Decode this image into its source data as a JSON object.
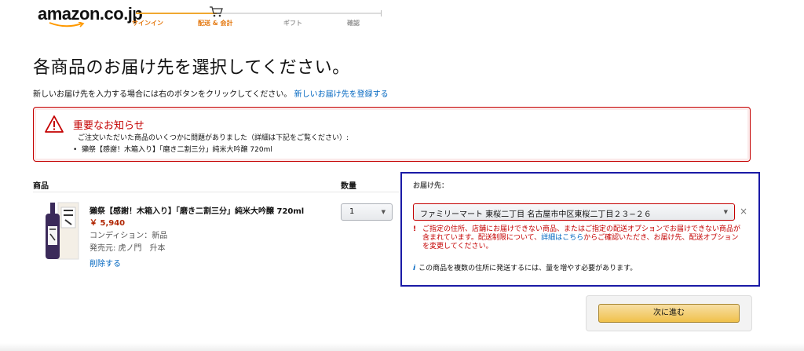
{
  "header": {
    "logo_text": "amazon.co.jp",
    "steps": [
      {
        "label": "サインイン",
        "state": "done"
      },
      {
        "label": "配送 & 会計",
        "state": "current"
      },
      {
        "label": "ギフト",
        "state": "todo"
      },
      {
        "label": "確認",
        "state": "todo"
      }
    ],
    "accent_color": "#e47911"
  },
  "page": {
    "title": "各商品のお届け先を選択してください。",
    "subtitle": "新しいお届け先を入力する場合には右のボタンをクリックしてください。",
    "new_address_link": "新しいお届け先を登録する"
  },
  "alert": {
    "title": "重要なお知らせ",
    "description": "ご注文いただいた商品のいくつかに問題がありました（詳細は下記をご覧ください）:",
    "items": [
      "獺祭【感謝！木箱入り】「磨き二割三分」純米大吟醸 720ml"
    ],
    "icon": "warning-icon",
    "color": "#c40000"
  },
  "columns": {
    "product": "商品",
    "quantity": "数量",
    "destination": "お届け先："
  },
  "product": {
    "name": "獺祭【感謝！木箱入り】「磨き二割三分」純米大吟醸 720ml",
    "price": "￥ 5,940",
    "condition": "コンディション：新品",
    "seller": "発売元: 虎ノ門　升本",
    "delete_label": "削除する",
    "quantity": "1"
  },
  "address": {
    "selected": "ファミリーマート 東桜二丁目 名古屋市中区東桜二丁目２３−２６",
    "close_symbol": "×",
    "warning_mark": "!",
    "warning_text_1": "ご指定の住所、店舗にお届けできない商品、またはご指定の配送オプションでお届けできない商品が含まれています。配送制限について、",
    "warning_link": "詳細はこちら",
    "warning_text_2": "からご確認いただき、お届け先、配送オプションを変更してください。",
    "info_mark": "i",
    "info_text": "この商品を複数の住所に発送するには、量を増やす必要があります。"
  },
  "actions": {
    "next_label": "次に進む",
    "button_color": "#f0c14b"
  }
}
